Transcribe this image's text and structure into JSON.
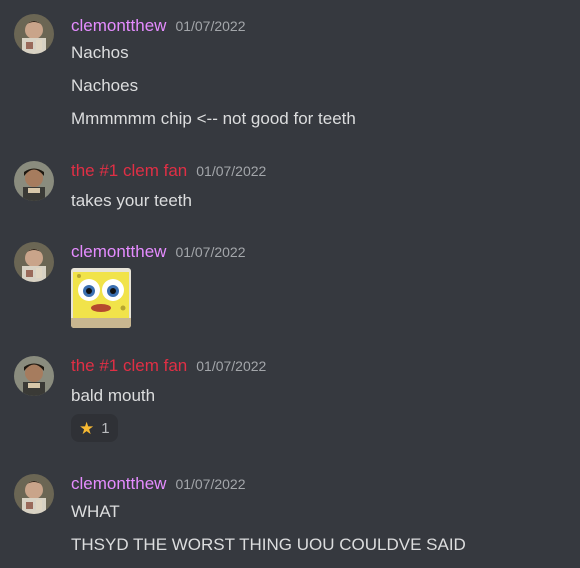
{
  "messages": [
    {
      "author": "clemontthew",
      "timestamp": "01/07/2022",
      "lines": [
        "Nachos",
        "Nachoes",
        "Mmmmmm chip <-- not good for teeth"
      ]
    },
    {
      "author": "the #1 clem fan",
      "timestamp": "01/07/2022",
      "lines": [
        "takes your teeth"
      ]
    },
    {
      "author": "clemontthew",
      "timestamp": "01/07/2022",
      "attachment": "spongebob-image"
    },
    {
      "author": "the #1 clem fan",
      "timestamp": "01/07/2022",
      "lines": [
        "bald mouth"
      ],
      "reaction": {
        "emoji": "★",
        "count": "1"
      }
    },
    {
      "author": "clemontthew",
      "timestamp": "01/07/2022",
      "lines": [
        "WHAT",
        "THSYD THE WORST THING UOU COULDVE SAID"
      ]
    }
  ],
  "colors": {
    "background": "#36393f",
    "clemontthew_name": "#e58cff",
    "clem_fan_name": "#e02f45",
    "text": "#dcddde",
    "timestamp": "#a3a6aa",
    "reaction_bg": "#2f3136",
    "star": "#f7b932"
  }
}
